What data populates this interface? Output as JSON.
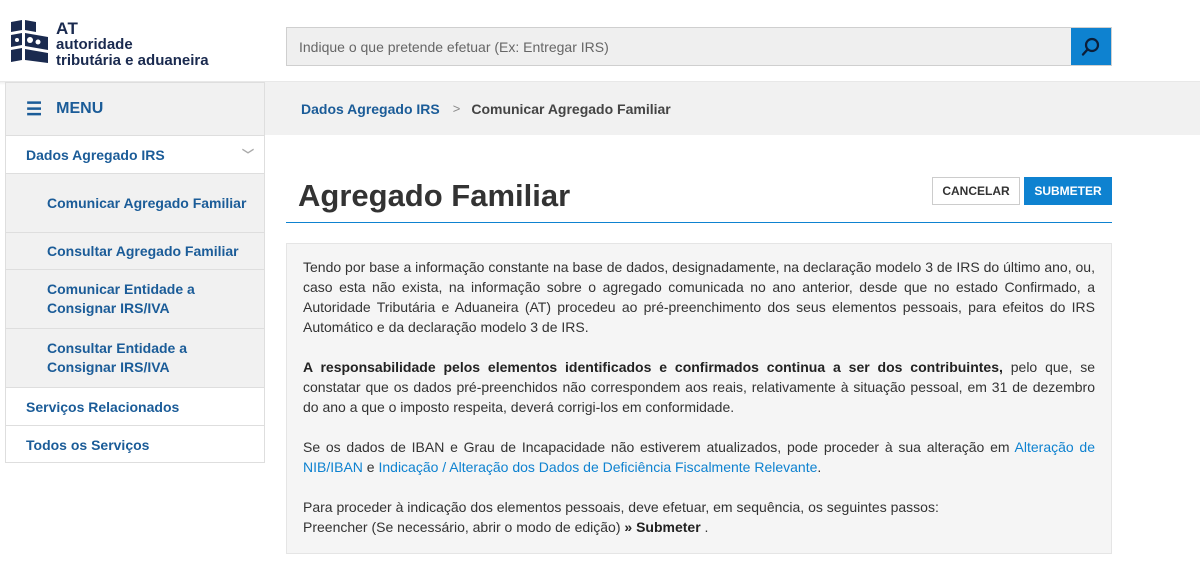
{
  "logo": {
    "line_at": "AT",
    "line1": "autoridade",
    "line2": "tributária e aduaneira"
  },
  "search": {
    "placeholder": "Indique o que pretende efetuar (Ex: Entregar IRS)"
  },
  "breadcrumb": {
    "link": "Dados Agregado IRS",
    "separator": ">",
    "current": "Comunicar Agregado Familiar"
  },
  "sidebar": {
    "menu_label": "MENU",
    "section_label": "Dados Agregado IRS",
    "sub_items": [
      "Comunicar Agregado Familiar",
      "Consultar Agregado Familiar",
      "Comunicar Entidade a Consignar IRS/IVA",
      "Consultar Entidade a Consignar IRS/IVA"
    ],
    "links": [
      "Serviços Relacionados",
      "Todos os Serviços"
    ]
  },
  "main": {
    "title": "Agregado Familiar",
    "cancel_label": "CANCELAR",
    "submit_label": "SUBMETER",
    "para1": "Tendo por base a informação constante na base de dados, designadamente, na declaração modelo 3 de IRS do último ano, ou, caso esta não exista, na informação sobre o agregado comunicada no ano anterior, desde que no estado Confirmado, a Autoridade Tributária e Aduaneira (AT) procedeu ao pré-preenchimento dos seus elementos pessoais, para efeitos do IRS Automático e da declaração modelo 3 de IRS.",
    "para2_bold": "A responsabilidade pelos elementos identificados e confirmados continua a ser dos contribuintes,",
    "para2_rest": " pelo que, se constatar que os dados pré-preenchidos não correspondem aos reais, relativamente à situação pessoal, em 31 de dezembro do ano a que o imposto respeita, deverá corrigi-los em conformidade.",
    "para3_a": "Se os dados de IBAN e Grau de Incapacidade não estiverem atualizados, pode proceder à sua alteração em ",
    "para3_link1": "Alteração de NIB/IBAN",
    "para3_b": " e ",
    "para3_link2": "Indicação / Alteração dos Dados de Deficiência Fiscalmente Relevante",
    "para3_c": ".",
    "para4_line1": "Para proceder à indicação dos elementos pessoais, deve efetuar, em sequência, os seguintes passos:",
    "para4_line2": "Preencher (Se necessário, abrir o modo de edição) ",
    "para4_bold": "» Submeter",
    "para4_end": " ."
  },
  "colors": {
    "brand_blue": "#0e82d0",
    "link_dark_blue": "#1b5c98",
    "logo_navy": "#1a2a4f"
  }
}
